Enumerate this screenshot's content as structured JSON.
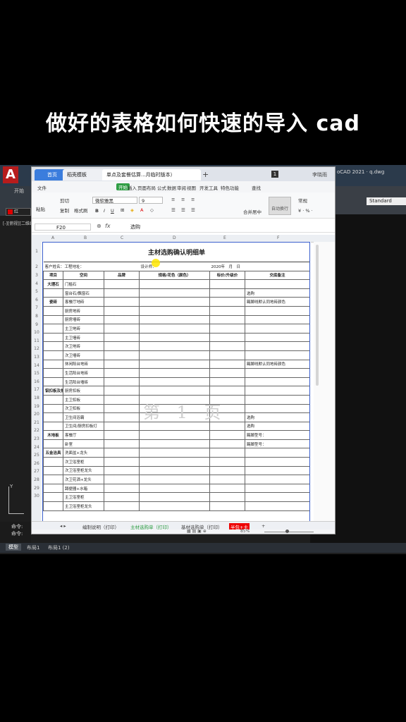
{
  "caption": "做好的表格如何快速的导入 cad",
  "cad": {
    "logo": "A",
    "title": "oCAD 2021 · q.dwg",
    "ribbon_tab": "开始",
    "left_label": "文件",
    "layer": "红",
    "style": "Standard",
    "wire": "[-][俯视][二维线框]",
    "command_lines": [
      "命令:",
      "命令:"
    ],
    "axis_label": "Y",
    "tabs": [
      "模型",
      "布局1",
      "布局1 (2)"
    ]
  },
  "wps": {
    "tabs": {
      "home": "首页",
      "template": "稻壳模板",
      "file": "单点及套餐估算...月临时版本）",
      "plus": "+"
    },
    "user": "李晓雨",
    "badge": "1",
    "menus": [
      "文件",
      "开始",
      "插入",
      "页面布局",
      "公式",
      "数据",
      "审阅",
      "视图",
      "开发工具",
      "特色功能",
      "查找"
    ],
    "toolbar": {
      "cut": "剪切",
      "paste": "粘贴",
      "copy": "复制",
      "format_painter": "格式刷",
      "font": "微软雅黑",
      "size": "9",
      "merge": "合并居中",
      "wrap": "自动换行",
      "number_format": "常规",
      "percent": "¥ · % ·"
    },
    "cell_ref": "F20",
    "fx": "fx",
    "formula": "选购",
    "columns": [
      "A",
      "B",
      "C",
      "D",
      "E",
      "F"
    ],
    "row_numbers": [
      "1",
      "2",
      "3",
      "4",
      "5",
      "6",
      "7",
      "8",
      "9",
      "10",
      "11",
      "12",
      "13",
      "14",
      "15",
      "16",
      "17",
      "18",
      "19",
      "20",
      "21",
      "22",
      "23",
      "24",
      "25",
      "26",
      "27",
      "28",
      "29",
      "30"
    ],
    "sheet": {
      "title": "主材选购确认明细单",
      "info": {
        "customer": "客户姓名：",
        "address": "工程地址：",
        "designer": "设计师：",
        "date": "2020年　月　日"
      },
      "headers": [
        "项目",
        "空间",
        "品牌",
        "规格/花色（颜色）",
        "标价/升级价",
        "交底备注"
      ],
      "rows": [
        [
          "大理石",
          "门槛石",
          "",
          "",
          "",
          ""
        ],
        [
          "",
          "窗台石/飘窗石",
          "",
          "",
          "",
          "选购"
        ],
        [
          "瓷砖",
          "客餐厅地砖",
          "",
          "",
          "",
          "踢脚线默认同地砖颜色"
        ],
        [
          "",
          "厨房地砖",
          "",
          "",
          "",
          ""
        ],
        [
          "",
          "厨房墙砖",
          "",
          "",
          "",
          ""
        ],
        [
          "",
          "主卫地砖",
          "",
          "",
          "",
          ""
        ],
        [
          "",
          "主卫墙砖",
          "",
          "",
          "",
          ""
        ],
        [
          "",
          "次卫地砖",
          "",
          "",
          "",
          ""
        ],
        [
          "",
          "次卫墙砖",
          "",
          "",
          "",
          ""
        ],
        [
          "",
          "休闲阳台地砖",
          "",
          "",
          "",
          "踢脚线默认同地砖颜色"
        ],
        [
          "",
          "生活阳台地砖",
          "",
          "",
          "",
          ""
        ],
        [
          "",
          "生活阳台墙砖",
          "",
          "",
          "",
          ""
        ],
        [
          "铝扣板及扣板灯具",
          "厨房扣板",
          "",
          "",
          "",
          ""
        ],
        [
          "",
          "主卫扣板",
          "",
          "",
          "",
          ""
        ],
        [
          "",
          "次卫扣板",
          "",
          "",
          "",
          ""
        ],
        [
          "",
          "卫生间浴霸",
          "",
          "",
          "",
          "选购"
        ],
        [
          "",
          "卫生间/厨房扣板灯",
          "",
          "",
          "",
          "选购"
        ],
        [
          "木地板",
          "客餐厅",
          "",
          "",
          "",
          "踢脚型号："
        ],
        [
          "",
          "卧室",
          "",
          "",
          "",
          "踢脚型号："
        ],
        [
          "五金洁具",
          "洗面盆+龙头",
          "",
          "",
          "",
          ""
        ],
        [
          "",
          "次卫浴室柜",
          "",
          "",
          "",
          ""
        ],
        [
          "",
          "次卫浴室柜龙头",
          "",
          "",
          "",
          ""
        ],
        [
          "",
          "次卫花洒+龙头",
          "",
          "",
          "",
          ""
        ],
        [
          "",
          "蹲便器+水箱",
          "",
          "",
          "",
          ""
        ],
        [
          "",
          "主卫浴室柜",
          "",
          "",
          "",
          ""
        ],
        [
          "",
          "主卫浴室柜龙头",
          "",
          "",
          "",
          ""
        ]
      ]
    },
    "watermark": "第 1 页",
    "sheet_tabs": [
      "编制说明（打印）",
      "主材选购单（打印）",
      "基材选购单（打印）",
      "半包+主"
    ],
    "zoom": "85%"
  }
}
